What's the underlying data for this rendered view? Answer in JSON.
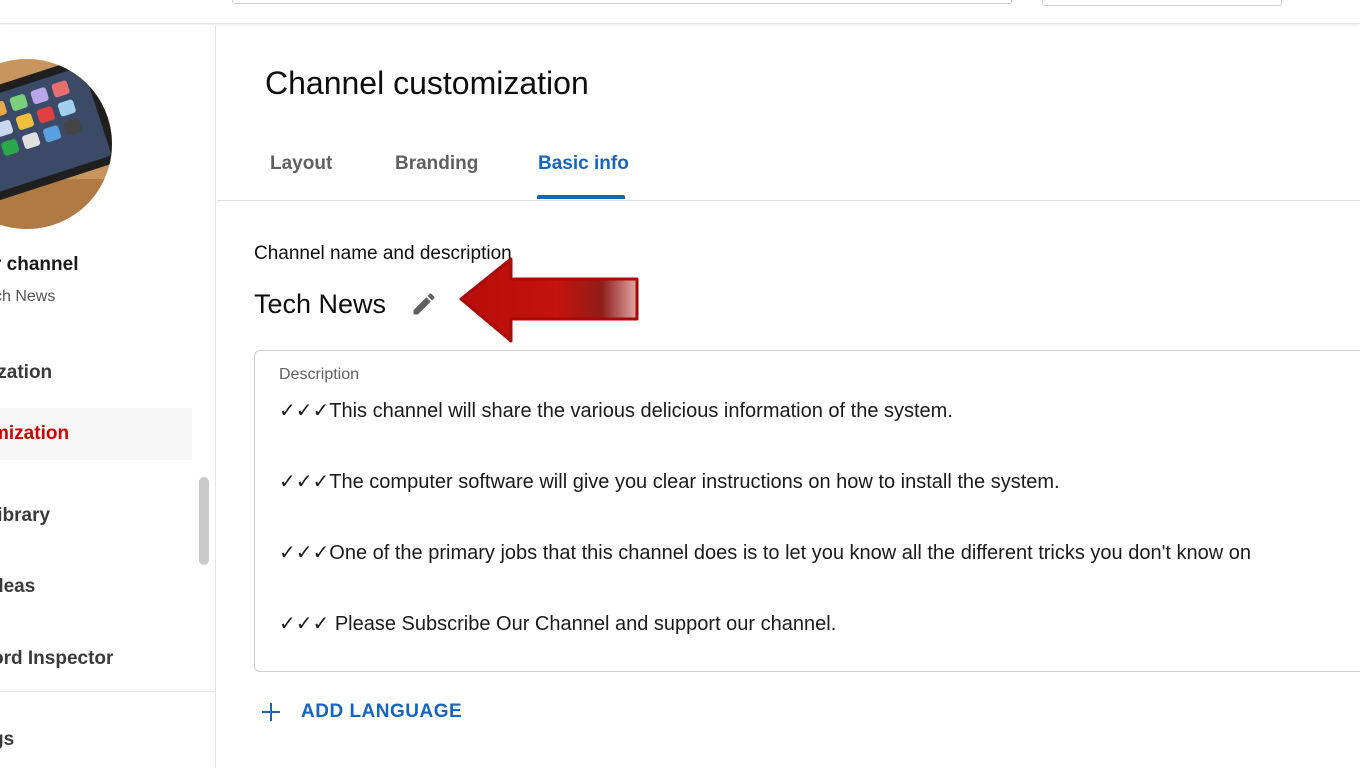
{
  "sidebar": {
    "channel_title": "r channel",
    "channel_subtitle": "ch News",
    "items": [
      {
        "label": "ization"
      },
      {
        "label": "mization"
      },
      {
        "label": "library"
      },
      {
        "label": "deas"
      },
      {
        "label": "ord Inspector"
      },
      {
        "label": "gs"
      }
    ]
  },
  "main": {
    "title": "Channel customization",
    "tabs": [
      {
        "label": "Layout"
      },
      {
        "label": "Branding"
      },
      {
        "label": "Basic info"
      }
    ],
    "section_label": "Channel name and description",
    "channel_name": "Tech News",
    "description": {
      "label": "Description",
      "lines": [
        "✓✓✓This channel will share the various delicious information of the system.",
        "✓✓✓The computer software will give you clear instructions on how to install the system.",
        "✓✓✓One of the primary jobs that this channel does is to let you know all the different tricks you don't know on",
        "✓✓✓ Please Subscribe Our Channel and support our channel."
      ]
    },
    "add_language_label": "ADD LANGUAGE"
  },
  "colors": {
    "accent_blue": "#1565c0",
    "active_red": "#cc0000",
    "annotation_arrow": "#c4120c"
  },
  "icons": {
    "edit": "pencil-icon",
    "add": "plus-icon",
    "annotation": "red-arrow-annotation"
  }
}
